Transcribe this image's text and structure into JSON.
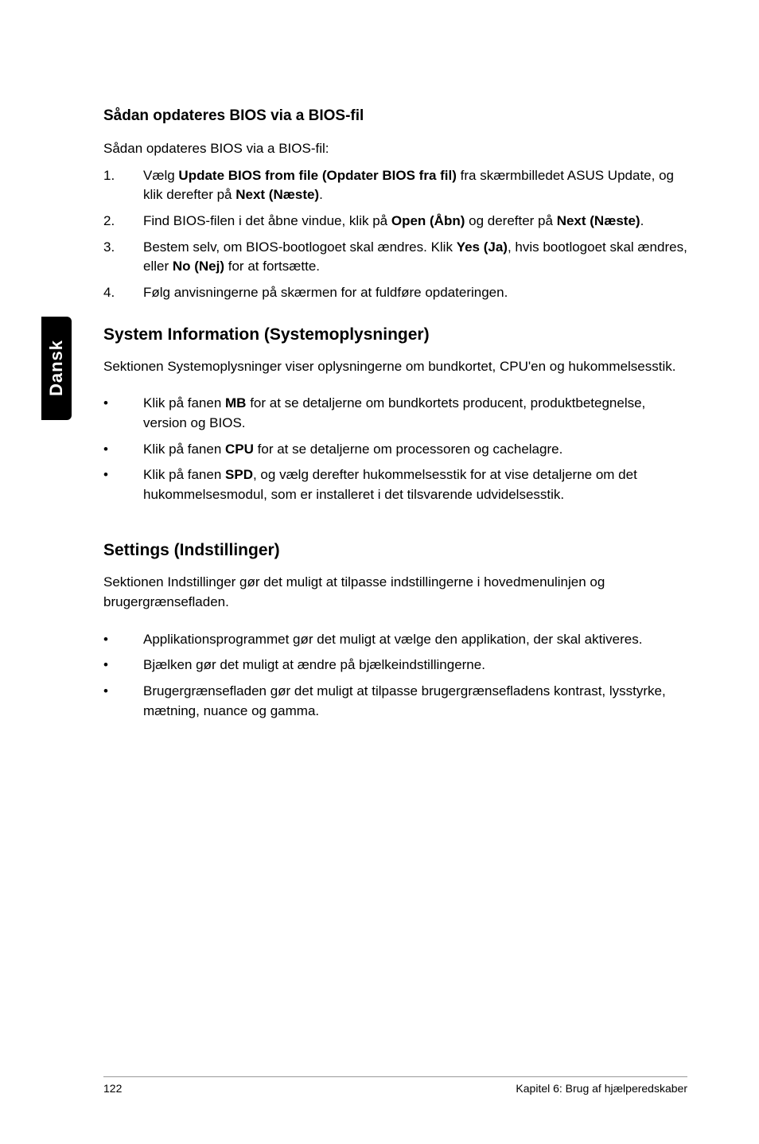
{
  "side_tab": "Dansk",
  "sec1": {
    "heading": "Sådan opdateres BIOS via a BIOS-fil",
    "intro": "Sådan opdateres BIOS via a BIOS-fil:",
    "items": [
      {
        "num": "1.",
        "pre": "Vælg ",
        "b1": "Update BIOS from file (Opdater BIOS fra fil)",
        "mid": " fra skærmbilledet ASUS Update, og klik derefter på ",
        "b2": "Next (Næste)",
        "post": "."
      },
      {
        "num": "2.",
        "pre": "Find BIOS-filen i det åbne vindue, klik på ",
        "b1": "Open (Åbn)",
        "mid": " og derefter på ",
        "b2": "Next (Næste)",
        "post": "."
      },
      {
        "num": "3.",
        "pre": "Bestem selv, om BIOS-bootlogoet skal ændres. Klik ",
        "b1": "Yes (Ja)",
        "mid": ", hvis bootlogoet skal ændres, eller ",
        "b2": "No (Nej)",
        "post": " for at fortsætte."
      },
      {
        "num": "4.",
        "pre": "Følg anvisningerne på skærmen for at fuldføre opdateringen.",
        "b1": "",
        "mid": "",
        "b2": "",
        "post": ""
      }
    ]
  },
  "sec2": {
    "heading": "System Information (Systemoplysninger)",
    "intro": "Sektionen Systemoplysninger viser oplysningerne om bundkortet, CPU'en og hukommelsesstik.",
    "items": [
      {
        "pre": "Klik på fanen ",
        "b": "MB",
        "post": " for at se detaljerne om bundkortets producent, produktbetegnelse, version og BIOS."
      },
      {
        "pre": "Klik på fanen ",
        "b": "CPU",
        "post": " for at se detaljerne om processoren og cachelagre."
      },
      {
        "pre": "Klik på fanen ",
        "b": "SPD",
        "post": ", og vælg derefter hukommelsesstik for at vise detaljerne om det hukommelsesmodul, som er installeret i det tilsvarende udvidelsesstik."
      }
    ]
  },
  "sec3": {
    "heading": "Settings (Indstillinger)",
    "intro": "Sektionen Indstillinger gør det muligt at tilpasse indstillingerne i hovedmenulinjen og brugergrænsefladen.",
    "items": [
      {
        "text": "Applikationsprogrammet gør det muligt at vælge den applikation, der skal aktiveres."
      },
      {
        "text": "Bjælken gør det muligt at ændre på bjælkeindstillingerne."
      },
      {
        "text": "Brugergrænsefladen gør det muligt at tilpasse brugergrænsefladens kontrast, lysstyrke, mætning, nuance og gamma."
      }
    ]
  },
  "footer": {
    "page": "122",
    "chapter": "Kapitel 6: Brug af hjælperedskaber"
  }
}
